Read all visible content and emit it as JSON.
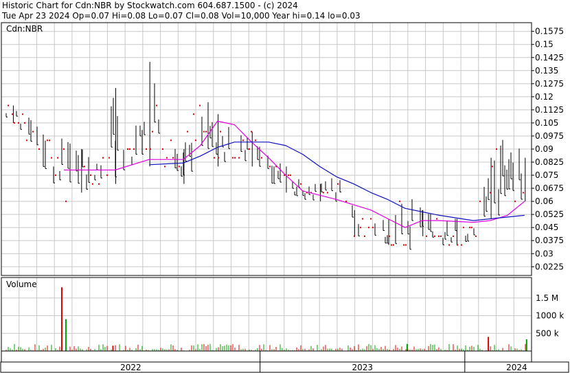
{
  "header": {
    "line1": "Historic Chart for Cdn:NBR by Stockwatch.com 604.687.1500 - (c) 2024",
    "line2": "Tue Apr 23 2024  Op=0.07  Hi=0.08  Lo=0.07  Cl=0.08  Vol=10,000  Year hi=0.14  lo=0.03"
  },
  "colors": {
    "background": "#ffffff",
    "grid": "#c8c8c8",
    "price_bar": "#000000",
    "single_trade_dot": "#dd0000",
    "ma_short": "#e000e0",
    "ma_long": "#1010c0",
    "volume_up": "#00a000",
    "volume_down": "#dd0000",
    "axis": "#000000"
  },
  "chart_data": [
    {
      "type": "candlestick",
      "title": "Cdn:NBR",
      "x_ticks": [
        "2022",
        "2023",
        "2024"
      ],
      "y_ticks": [
        "0.1575",
        "0.15",
        "0.1425",
        "0.135",
        "0.1275",
        "0.12",
        "0.1125",
        "0.105",
        "0.0975",
        "0.09",
        "0.0825",
        "0.075",
        "0.0675",
        "0.06",
        "0.0525",
        "0.045",
        "0.0375",
        "0.03",
        "0.0225"
      ],
      "ylim": [
        0.0175,
        0.1625
      ],
      "grid": true,
      "y_axis_side": "right",
      "ohlc_samples": [
        {
          "date": "2021-10",
          "low": 0.105,
          "high": 0.115
        },
        {
          "date": "2022-01",
          "low": 0.06,
          "high": 0.095
        },
        {
          "date": "2022-02",
          "low": 0.065,
          "high": 0.09
        },
        {
          "date": "2022-03",
          "low": 0.07,
          "high": 0.085
        },
        {
          "date": "2022-04",
          "low": 0.07,
          "high": 0.125
        },
        {
          "date": "2022-05",
          "low": 0.075,
          "high": 0.095
        },
        {
          "date": "2022-06",
          "low": 0.08,
          "high": 0.14
        },
        {
          "date": "2022-07",
          "low": 0.08,
          "high": 0.095
        },
        {
          "date": "2022-08",
          "low": 0.07,
          "high": 0.09
        },
        {
          "date": "2022-09",
          "low": 0.085,
          "high": 0.135
        },
        {
          "date": "2022-10",
          "low": 0.08,
          "high": 0.11
        },
        {
          "date": "2022-11",
          "low": 0.085,
          "high": 0.1
        },
        {
          "date": "2022-12",
          "low": 0.08,
          "high": 0.1
        },
        {
          "date": "2023-01",
          "low": 0.07,
          "high": 0.085
        },
        {
          "date": "2023-02",
          "low": 0.065,
          "high": 0.08
        },
        {
          "date": "2023-03",
          "low": 0.06,
          "high": 0.07
        },
        {
          "date": "2023-04",
          "low": 0.06,
          "high": 0.07
        },
        {
          "date": "2023-05",
          "low": 0.06,
          "high": 0.075
        },
        {
          "date": "2023-06",
          "low": 0.04,
          "high": 0.055
        },
        {
          "date": "2023-07",
          "low": 0.04,
          "high": 0.05
        },
        {
          "date": "2023-08",
          "low": 0.035,
          "high": 0.05
        },
        {
          "date": "2023-09",
          "low": 0.03,
          "high": 0.065
        },
        {
          "date": "2023-10",
          "low": 0.04,
          "high": 0.055
        },
        {
          "date": "2023-11",
          "low": 0.035,
          "high": 0.05
        },
        {
          "date": "2023-12",
          "low": 0.035,
          "high": 0.05
        },
        {
          "date": "2024-01",
          "low": 0.035,
          "high": 0.045
        },
        {
          "date": "2024-02",
          "low": 0.05,
          "high": 0.085
        },
        {
          "date": "2024-03",
          "low": 0.05,
          "high": 0.1
        },
        {
          "date": "2024-04",
          "low": 0.06,
          "high": 0.085
        }
      ],
      "ma_short_samples": [
        {
          "date": "2022-01",
          "value": 0.078
        },
        {
          "date": "2022-04",
          "value": 0.078
        },
        {
          "date": "2022-06",
          "value": 0.084
        },
        {
          "date": "2022-08",
          "value": 0.084
        },
        {
          "date": "2022-09",
          "value": 0.092
        },
        {
          "date": "2022-10",
          "value": 0.106
        },
        {
          "date": "2022-11",
          "value": 0.104
        },
        {
          "date": "2022-12",
          "value": 0.094
        },
        {
          "date": "2023-01",
          "value": 0.085
        },
        {
          "date": "2023-02",
          "value": 0.075
        },
        {
          "date": "2023-03",
          "value": 0.066
        },
        {
          "date": "2023-05",
          "value": 0.061
        },
        {
          "date": "2023-06",
          "value": 0.058
        },
        {
          "date": "2023-07",
          "value": 0.055
        },
        {
          "date": "2023-08",
          "value": 0.05
        },
        {
          "date": "2023-09",
          "value": 0.045
        },
        {
          "date": "2023-10",
          "value": 0.049
        },
        {
          "date": "2023-11",
          "value": 0.049
        },
        {
          "date": "2024-01",
          "value": 0.048
        },
        {
          "date": "2024-02",
          "value": 0.049
        },
        {
          "date": "2024-03",
          "value": 0.052
        },
        {
          "date": "2024-04",
          "value": 0.06
        }
      ],
      "ma_long_samples": [
        {
          "date": "2022-06",
          "value": 0.081
        },
        {
          "date": "2022-08",
          "value": 0.082
        },
        {
          "date": "2022-09",
          "value": 0.086
        },
        {
          "date": "2022-10",
          "value": 0.091
        },
        {
          "date": "2022-11",
          "value": 0.094
        },
        {
          "date": "2023-01",
          "value": 0.094
        },
        {
          "date": "2023-02",
          "value": 0.092
        },
        {
          "date": "2023-03",
          "value": 0.087
        },
        {
          "date": "2023-04",
          "value": 0.08
        },
        {
          "date": "2023-05",
          "value": 0.074
        },
        {
          "date": "2023-06",
          "value": 0.07
        },
        {
          "date": "2023-07",
          "value": 0.065
        },
        {
          "date": "2023-08",
          "value": 0.061
        },
        {
          "date": "2023-09",
          "value": 0.056
        },
        {
          "date": "2023-10",
          "value": 0.054
        },
        {
          "date": "2023-11",
          "value": 0.052
        },
        {
          "date": "2024-01",
          "value": 0.049
        },
        {
          "date": "2024-02",
          "value": 0.05
        },
        {
          "date": "2024-03",
          "value": 0.051
        },
        {
          "date": "2024-04",
          "value": 0.052
        }
      ]
    },
    {
      "type": "bar",
      "title": "Volume",
      "y_ticks": [
        "1.5 M",
        "1000 k",
        "500 k"
      ],
      "ylim": [
        0,
        2000000
      ],
      "grid": true,
      "spikes": [
        {
          "date": "2022-01",
          "value": 1800000
        },
        {
          "date": "2022-01",
          "value": 900000
        },
        {
          "date": "2022-04",
          "value": 150000
        },
        {
          "date": "2023-09",
          "value": 200000
        },
        {
          "date": "2024-02",
          "value": 400000
        },
        {
          "date": "2024-04",
          "value": 330000
        }
      ]
    }
  ]
}
